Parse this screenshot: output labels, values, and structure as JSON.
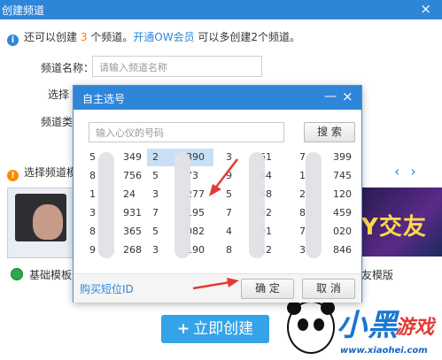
{
  "window": {
    "title": "创建频道",
    "close": "×"
  },
  "info": {
    "part1": "还可以创建 ",
    "count": "3",
    "part2": " 个频道。",
    "link": "开通OW会员",
    "part3": " 可以多创建2个频道。"
  },
  "form": {
    "name_label": "频道名称：",
    "name_placeholder": "请输入频道名称",
    "select_label": "选择",
    "select_value": "1",
    "type_label": "频道类"
  },
  "template": {
    "title": "选择频道模",
    "prev": "‹",
    "next": "›",
    "basic_label": "基础模板",
    "right_label": "友模版",
    "right_thumb_text": "Y交友"
  },
  "create_button": {
    "plus": "+",
    "label": "立即创建"
  },
  "logo": {
    "brand": "小黑",
    "brand2": "游戏",
    "url": "www.xiaohei.com"
  },
  "modal": {
    "title": "自主选号",
    "minimize": "—",
    "close": "×",
    "search_placeholder": "输入心仪的号码",
    "search_button": "搜 索",
    "buy_link": "购买短位ID",
    "ok_button": "确 定",
    "cancel_button": "取 消",
    "numbers": [
      [
        {
          "l": "5",
          "r": "349"
        },
        {
          "l": "2",
          "r": "390",
          "selected": true
        },
        {
          "l": "3",
          "r": "61"
        },
        {
          "l": "7",
          "r": "399"
        }
      ],
      [
        {
          "l": "8",
          "r": "756"
        },
        {
          "l": "5",
          "r": "73"
        },
        {
          "l": "9",
          "r": "44"
        },
        {
          "l": "1",
          "r": "745"
        }
      ],
      [
        {
          "l": "1",
          "r": "24"
        },
        {
          "l": "3",
          "r": "277"
        },
        {
          "l": "5",
          "r": "48"
        },
        {
          "l": "2",
          "r": "120"
        }
      ],
      [
        {
          "l": "3",
          "r": "931"
        },
        {
          "l": "7",
          "r": "195"
        },
        {
          "l": "7",
          "r": "02"
        },
        {
          "l": "8",
          "r": "459"
        }
      ],
      [
        {
          "l": "8",
          "r": "365"
        },
        {
          "l": "5",
          "r": "082"
        },
        {
          "l": "4",
          "r": "91"
        },
        {
          "l": "7",
          "r": "020"
        }
      ],
      [
        {
          "l": "9",
          "r": "268"
        },
        {
          "l": "3",
          "r": "190"
        },
        {
          "l": "8",
          "r": "12"
        },
        {
          "l": "3",
          "r": "846"
        }
      ]
    ]
  },
  "colors": {
    "accent": "#2f86d9",
    "highlight": "#ff7a00",
    "annotation": "#e53935"
  }
}
